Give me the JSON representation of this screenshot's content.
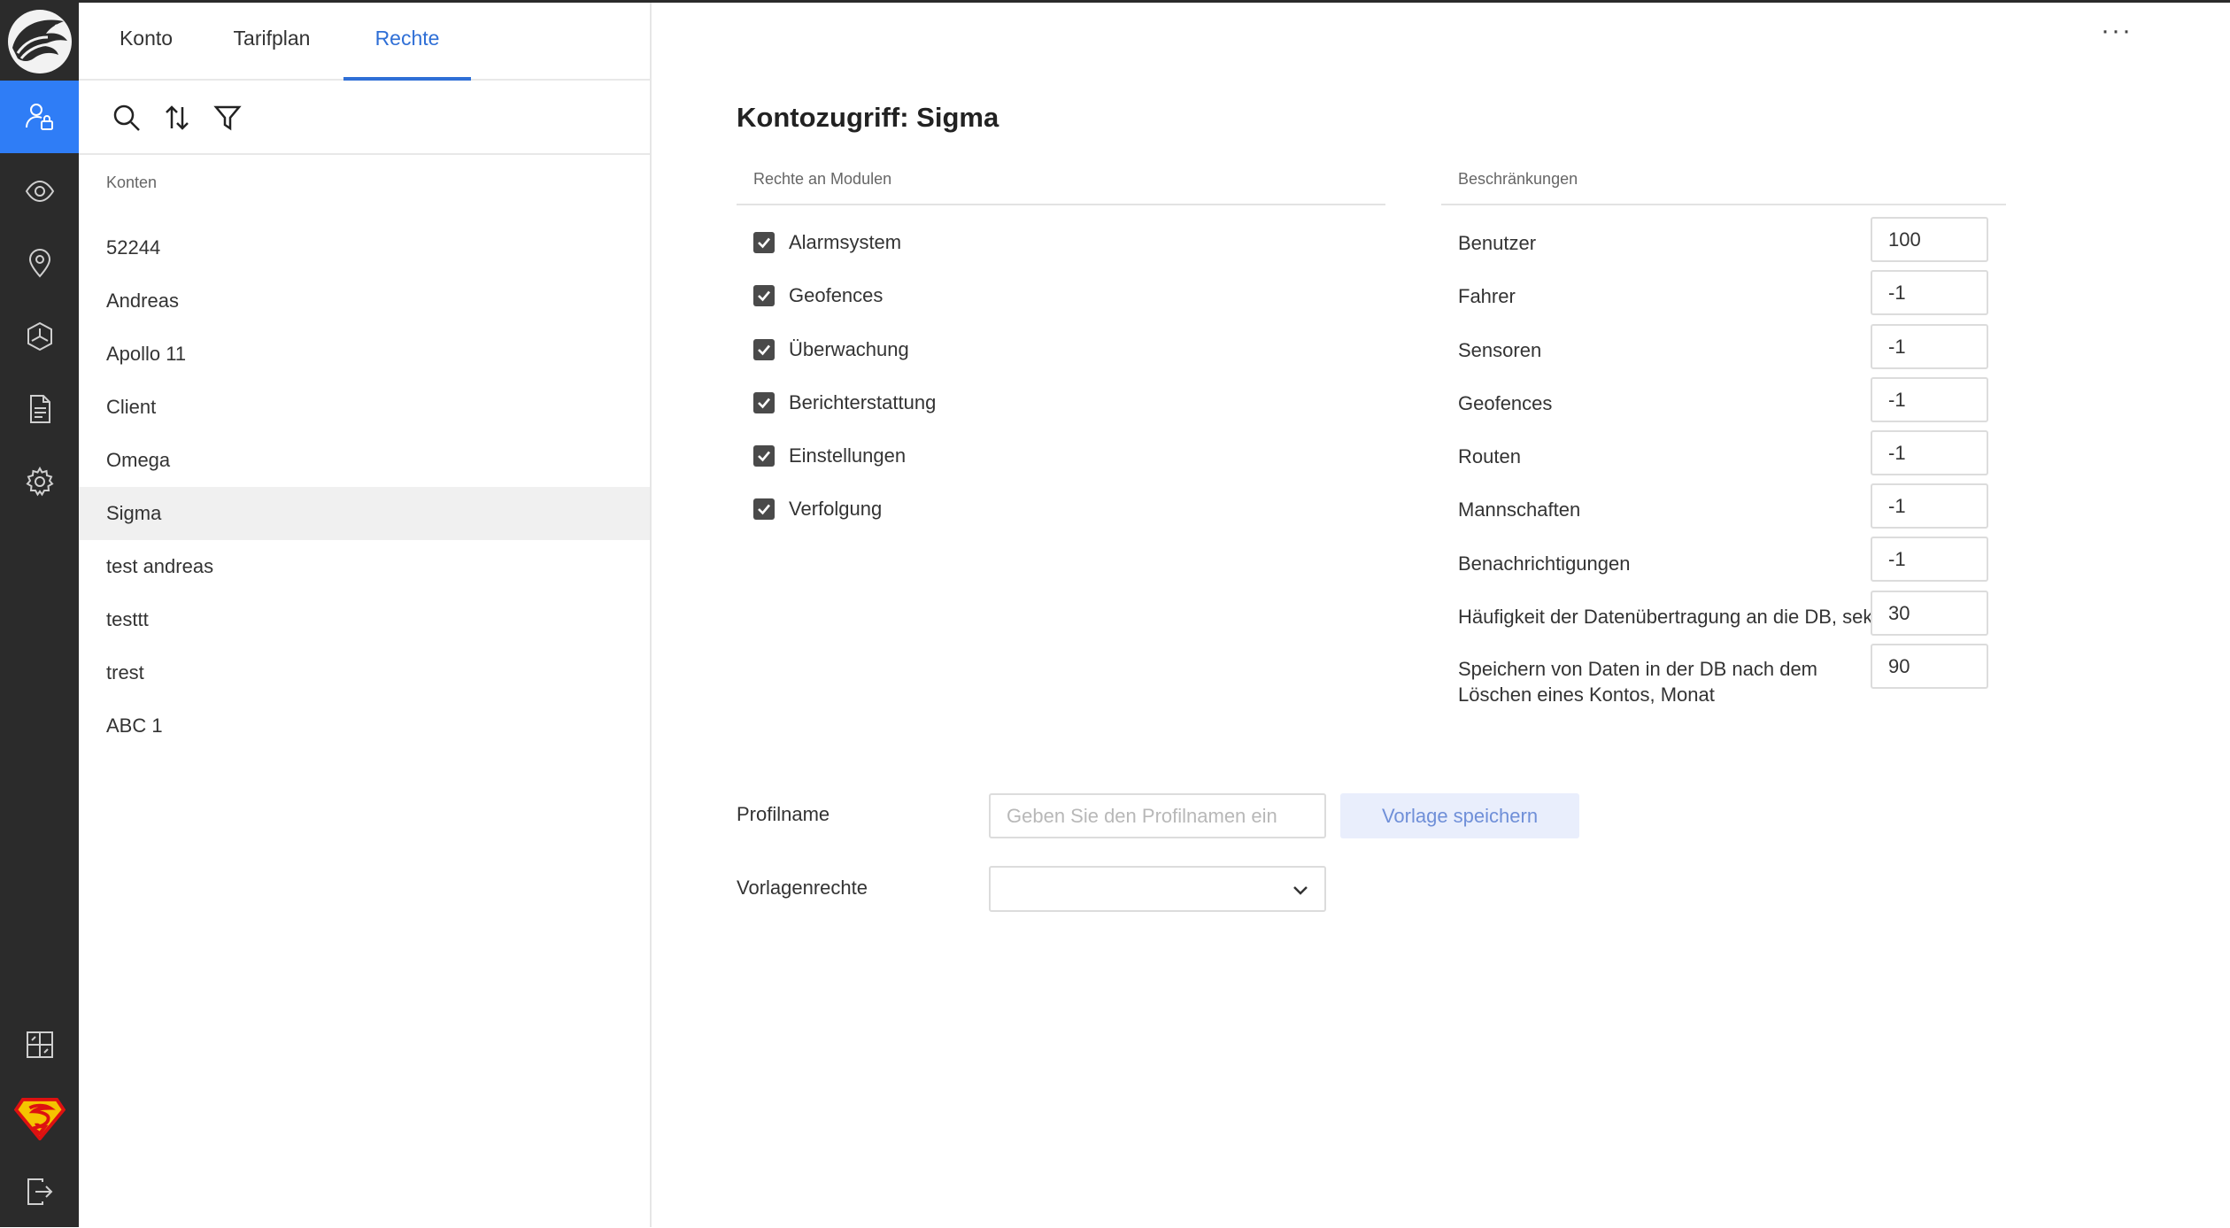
{
  "tabs": [
    {
      "label": "Konto"
    },
    {
      "label": "Tarifplan"
    },
    {
      "label": "Rechte",
      "active": true
    }
  ],
  "accounts": {
    "header": "Konten",
    "items": [
      {
        "label": "52244"
      },
      {
        "label": "Andreas"
      },
      {
        "label": "Apollo 11"
      },
      {
        "label": "Client"
      },
      {
        "label": "Omega"
      },
      {
        "label": "Sigma",
        "selected": true
      },
      {
        "label": "test andreas"
      },
      {
        "label": "testtt"
      },
      {
        "label": "trest"
      },
      {
        "label": "ABC 1"
      }
    ]
  },
  "main": {
    "title": "Kontozugriff: Sigma",
    "more_label": "···",
    "modules": {
      "header": "Rechte an Modulen",
      "items": [
        {
          "label": "Alarmsystem",
          "checked": true
        },
        {
          "label": "Geofences",
          "checked": true
        },
        {
          "label": "Überwachung",
          "checked": true
        },
        {
          "label": "Berichterstattung",
          "checked": true
        },
        {
          "label": "Einstellungen",
          "checked": true
        },
        {
          "label": "Verfolgung",
          "checked": true
        }
      ]
    },
    "limits": {
      "header": "Beschränkungen",
      "items": [
        {
          "label": "Benutzer",
          "value": "100"
        },
        {
          "label": "Fahrer",
          "value": "-1"
        },
        {
          "label": "Sensoren",
          "value": "-1"
        },
        {
          "label": "Geofences",
          "value": "-1"
        },
        {
          "label": "Routen",
          "value": "-1"
        },
        {
          "label": "Mannschaften",
          "value": "-1"
        },
        {
          "label": "Benachrichtigungen",
          "value": "-1"
        },
        {
          "label": "Häufigkeit der Datenübertragung an die DB, sek",
          "value": "30"
        },
        {
          "label": "Speichern von Daten in der DB nach dem Löschen eines Kontos, Monat",
          "value": "90"
        }
      ]
    },
    "profile": {
      "label": "Profilname",
      "placeholder": "Geben Sie den Profilnamen ein",
      "value": "",
      "save_label": "Vorlage speichern"
    },
    "template_rights": {
      "label": "Vorlagenrechte",
      "value": ""
    }
  },
  "colors": {
    "rail": "#2b2b2b",
    "accent": "#2f7df6",
    "tab_active": "#2f6fd6",
    "selected_row": "#f0f0f0"
  }
}
